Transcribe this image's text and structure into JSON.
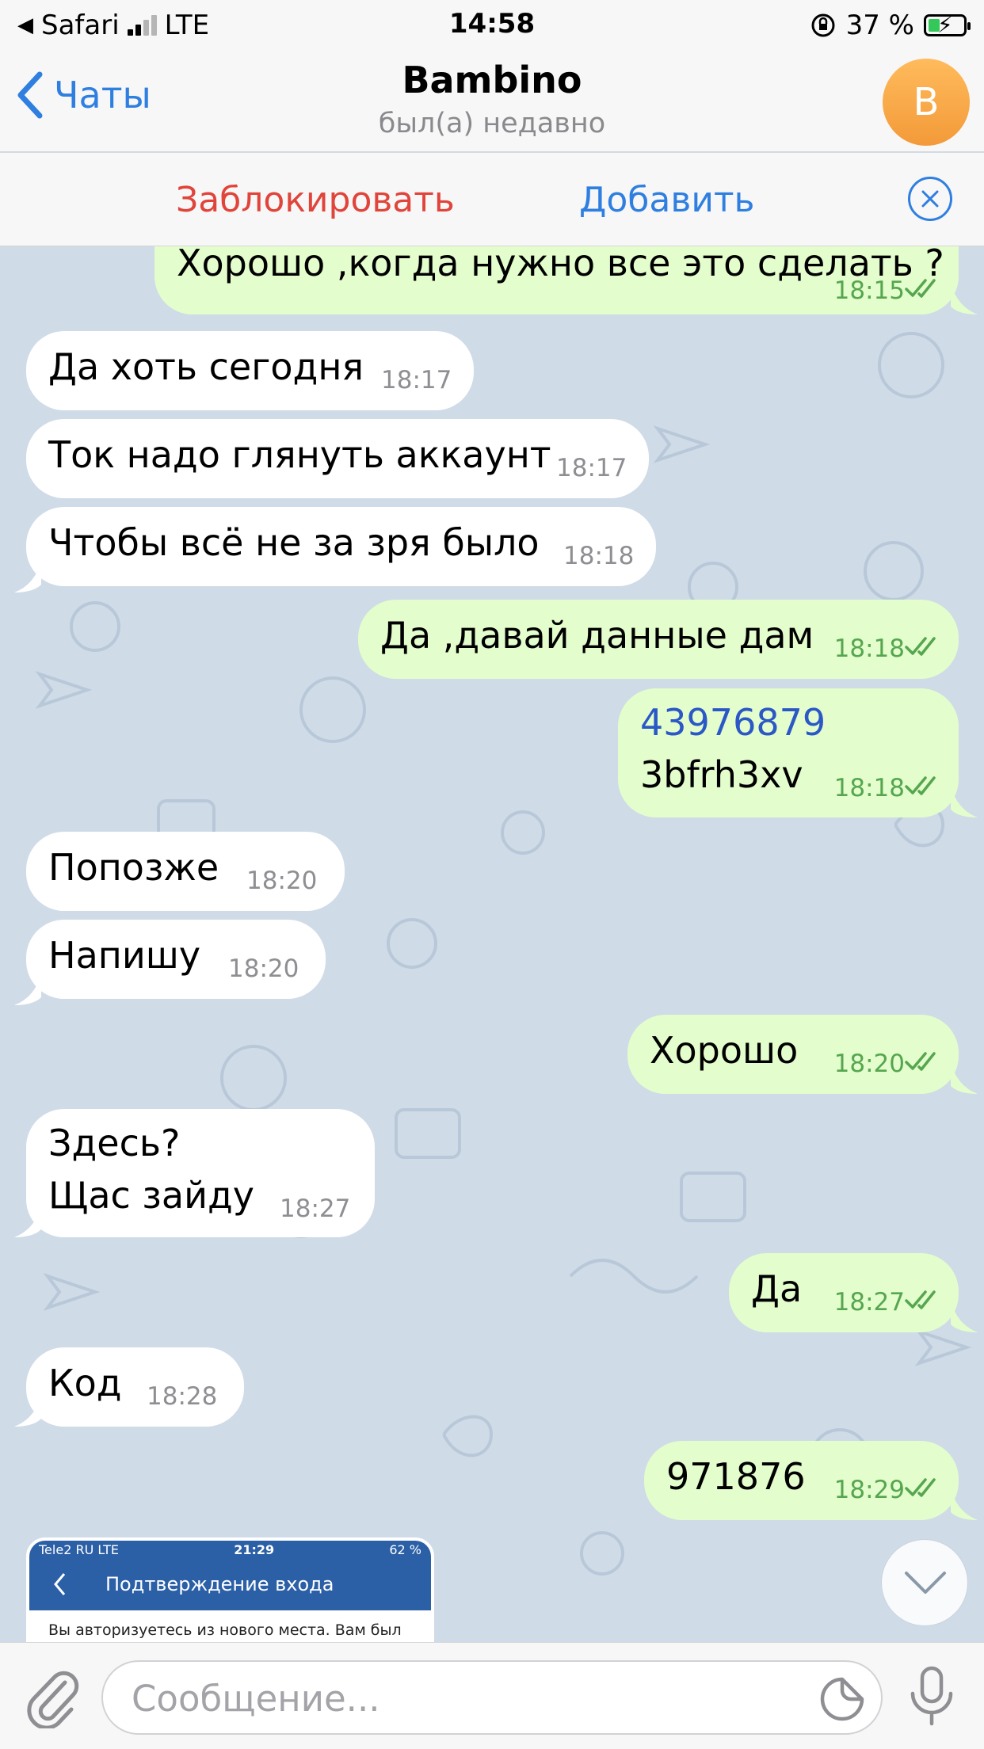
{
  "status_bar": {
    "carrier_app": "Safari",
    "network": "LTE",
    "time": "14:58",
    "battery": "37 %"
  },
  "nav": {
    "back_label": "Чаты",
    "title": "Bambino",
    "subtitle": "был(а) недавно",
    "avatar_letter": "B"
  },
  "action_bar": {
    "block_label": "Заблокировать",
    "add_label": "Добавить"
  },
  "messages": [
    {
      "dir": "out",
      "text": "Хорошо ,когда нужно все это сделать ?",
      "time": "18:15",
      "read": true
    },
    {
      "dir": "in",
      "text": "Да хоть сегодня",
      "time": "18:17"
    },
    {
      "dir": "in",
      "text": "Ток надо глянуть аккаунт",
      "time": "18:17"
    },
    {
      "dir": "in",
      "text": "Чтобы всё не за зря было",
      "time": "18:18"
    },
    {
      "dir": "out",
      "text": "Да ,давай данные дам",
      "time": "18:18",
      "read": true
    },
    {
      "dir": "out",
      "line1": "43976879",
      "line2": "3bfrh3xv",
      "time": "18:18",
      "read": true
    },
    {
      "dir": "in",
      "text": "Попозже",
      "time": "18:20"
    },
    {
      "dir": "in",
      "text": "Напишу",
      "time": "18:20"
    },
    {
      "dir": "out",
      "text": "Хорошо",
      "time": "18:20",
      "read": true
    },
    {
      "dir": "in",
      "line1": "Здесь?",
      "line2": "Щас зайду",
      "time": "18:27"
    },
    {
      "dir": "out",
      "text": "Да",
      "time": "18:27",
      "read": true
    },
    {
      "dir": "in",
      "text": "Код",
      "time": "18:28"
    },
    {
      "dir": "out",
      "text": "971876",
      "time": "18:29",
      "read": true
    }
  ],
  "photo_preview": {
    "carrier": "Tele2 RU  LTE",
    "time": "21:29",
    "battery": "62 %",
    "title": "Подтверждение входа",
    "body": "Вы авторизуетесь из нового места. Вам был"
  },
  "input": {
    "placeholder": "Сообщение..."
  }
}
